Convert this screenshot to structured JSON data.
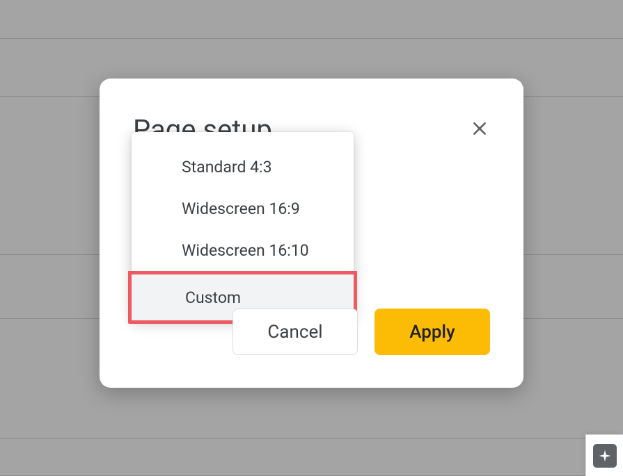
{
  "dialog": {
    "title": "Page setup",
    "options": [
      {
        "label": "Standard 4:3"
      },
      {
        "label": "Widescreen 16:9"
      },
      {
        "label": "Widescreen 16:10"
      },
      {
        "label": "Custom"
      }
    ],
    "cancel_label": "Cancel",
    "apply_label": "Apply"
  }
}
